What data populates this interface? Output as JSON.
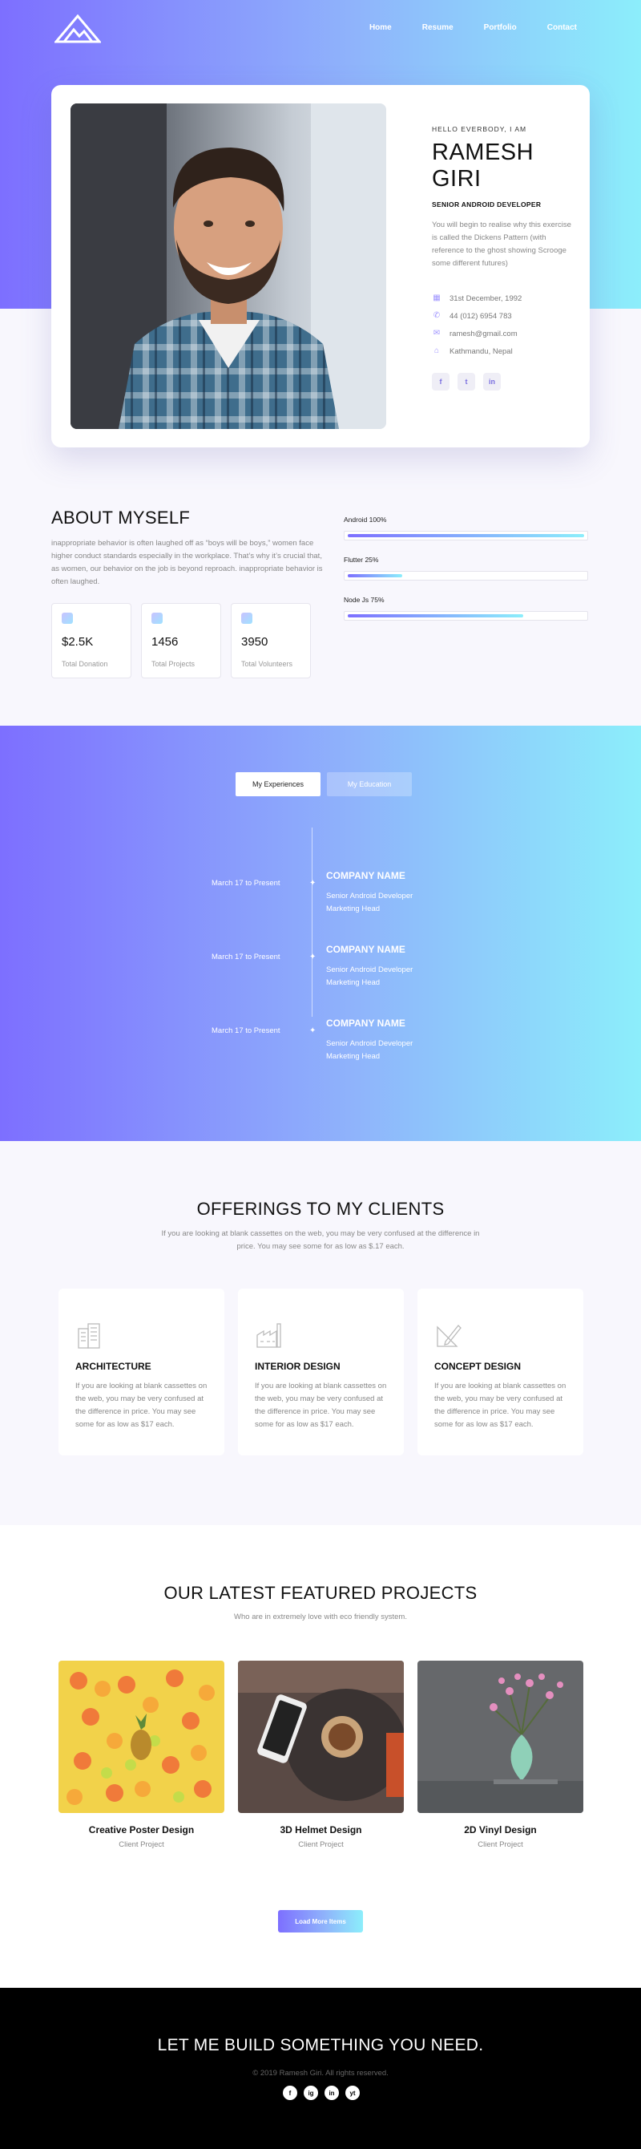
{
  "colors": {
    "gradient_start": "#7d6fff",
    "gradient_end": "#8ceefb",
    "footer_bg": "#000000"
  },
  "nav": {
    "logo_icon": "mountain-logo-icon",
    "items": [
      "Home",
      "Resume",
      "Portfolio",
      "Contact"
    ]
  },
  "profile": {
    "greeting": "HELLO EVERBODY, I AM",
    "name": "RAMESH GIRI",
    "role": "SENIOR ANDROID DEVELOPER",
    "bio": "You will begin to realise why this exercise is called the Dickens Pattern (with reference to the ghost showing Scrooge some different futures)",
    "contacts": [
      {
        "icon": "calendar-icon",
        "text": "31st December, 1992"
      },
      {
        "icon": "phone-icon",
        "text": "44 (012) 6954 783"
      },
      {
        "icon": "mail-icon",
        "text": "ramesh@gmail.com"
      },
      {
        "icon": "home-icon",
        "text": "Kathmandu, Nepal"
      }
    ],
    "socials": [
      "f",
      "t",
      "in"
    ]
  },
  "about": {
    "title": "ABOUT MYSELF",
    "text": "inappropriate behavior is often laughed off as “boys will be boys,” women face higher conduct standards especially in the workplace. That’s why it’s crucial that, as women, our behavior on the job is beyond reproach. inappropriate behavior is often laughed.",
    "stats": [
      {
        "value": "$2.5K",
        "label": "Total Donation"
      },
      {
        "value": "1456",
        "label": "Total Projects"
      },
      {
        "value": "3950",
        "label": "Total Volunteers"
      }
    ],
    "skills": [
      {
        "label": "Android 100%",
        "percent": 100
      },
      {
        "label": "Flutter 25%",
        "percent": 25
      },
      {
        "label": "Node Js 75%",
        "percent": 75
      }
    ]
  },
  "experience": {
    "tabs": [
      {
        "label": "My Experiences",
        "active": true
      },
      {
        "label": "My Education",
        "active": false
      }
    ],
    "items": [
      {
        "date": "March 17 to Present",
        "company": "COMPANY NAME",
        "line1": "Senior Android Developer",
        "line2": "Marketing Head"
      },
      {
        "date": "March 17 to Present",
        "company": "COMPANY NAME",
        "line1": "Senior Android Developer",
        "line2": "Marketing Head"
      },
      {
        "date": "March 17 to Present",
        "company": "COMPANY NAME",
        "line1": "Senior Android Developer",
        "line2": "Marketing Head"
      }
    ]
  },
  "offerings": {
    "title": "OFFERINGS TO MY CLIENTS",
    "subtitle": "If you are looking at blank cassettes on the web, you may be very confused at the difference in price. You may see some for as low as $.17 each.",
    "cards": [
      {
        "icon": "building-icon",
        "title": "ARCHITECTURE",
        "text": "If you are looking at blank cassettes on the web, you may be very confused at the difference in price. You may see some for as low as $17 each."
      },
      {
        "icon": "factory-icon",
        "title": "INTERIOR DESIGN",
        "text": "If you are looking at blank cassettes on the web, you may be very confused at the difference in price. You may see some for as low as $17 each."
      },
      {
        "icon": "pencil-ruler-icon",
        "title": "CONCEPT DESIGN",
        "text": "If you are looking at blank cassettes on the web, you may be very confused at the difference in price. You may see some for as low as $17 each."
      }
    ]
  },
  "projects": {
    "title": "OUR LATEST FEATURED PROJECTS",
    "subtitle": "Who are in extremely love with eco friendly system.",
    "items": [
      {
        "title": "Creative Poster Design",
        "category": "Client Project"
      },
      {
        "title": "3D Helmet Design",
        "category": "Client Project"
      },
      {
        "title": "2D Vinyl Design",
        "category": "Client Project"
      }
    ],
    "load_more": "Load More Items"
  },
  "footer": {
    "title": "LET ME BUILD SOMETHING YOU NEED.",
    "copyright": "© 2019 Ramesh Giri. All rights reserved.",
    "socials": [
      "f",
      "ig",
      "in",
      "yt"
    ]
  }
}
